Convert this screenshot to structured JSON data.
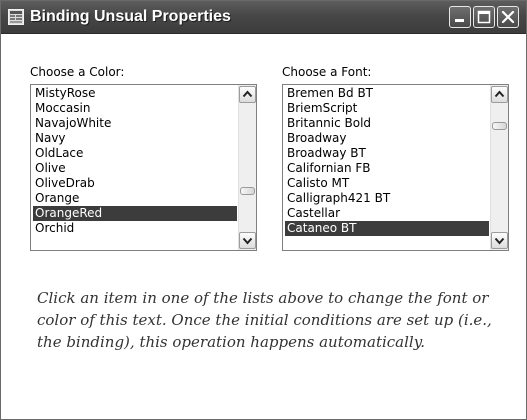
{
  "window": {
    "title": "Binding Unsual Properties",
    "controls": {
      "minimize_icon": "minimize-icon",
      "maximize_icon": "maximize-icon",
      "close_icon": "close-icon"
    }
  },
  "color_list": {
    "label": "Choose a Color:",
    "items": [
      "MistyRose",
      "Moccasin",
      "NavajoWhite",
      "Navy",
      "OldLace",
      "Olive",
      "OliveDrab",
      "Orange",
      "OrangeRed",
      "Orchid"
    ],
    "selected": "OrangeRed"
  },
  "font_list": {
    "label": "Choose a Font:",
    "items": [
      "Bremen Bd BT",
      "BriemScript",
      "Britannic Bold",
      "Broadway",
      "Broadway BT",
      "Californian FB",
      "Calisto MT",
      "Calligraph421 BT",
      "Castellar",
      "Cataneo BT"
    ],
    "selected": "Cataneo BT"
  },
  "description": "Click an item in one of the lists above to change the font or color of this text. Once the initial conditions are set up (i.e., the binding), this operation happens automatically.",
  "colors": {
    "selection_bg": "#3c3c3c",
    "title_bar": "#4a4a4a",
    "description_text": "#333333"
  }
}
